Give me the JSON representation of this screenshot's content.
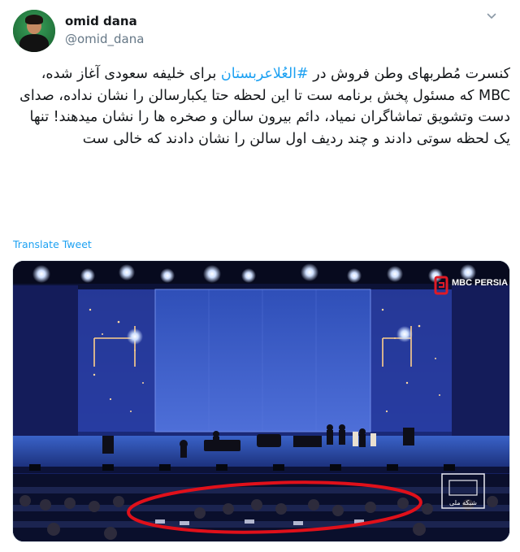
{
  "user": {
    "display_name": "omid dana",
    "handle": "@omid_dana"
  },
  "tweet": {
    "text_before": "کنسرت مُطربهای وطن فروش در ",
    "hashtag": "#العُلاعربستان",
    "text_after": " برای خلیفه سعودی آغاز شده، MBC که مسئول پخش برنامه ست تا این لحظه حتا یکبارسالن را نشان نداده، صدای دست وتشویق تماشاگران نمیاد، دائم بیرون سالن و صخره ها را نشان میدهند! تنها یک لحظه سوتی دادند و چند ردیف اول سالن را نشان دادند که خالی ست",
    "translate_label": "Translate Tweet"
  },
  "media": {
    "watermark_top": "MBC PERSIA",
    "watermark_bottom": "شبکه ملی"
  },
  "colors": {
    "link": "#1da1f2",
    "secondary_text": "#657786",
    "highlight_circle": "#e0101a"
  }
}
